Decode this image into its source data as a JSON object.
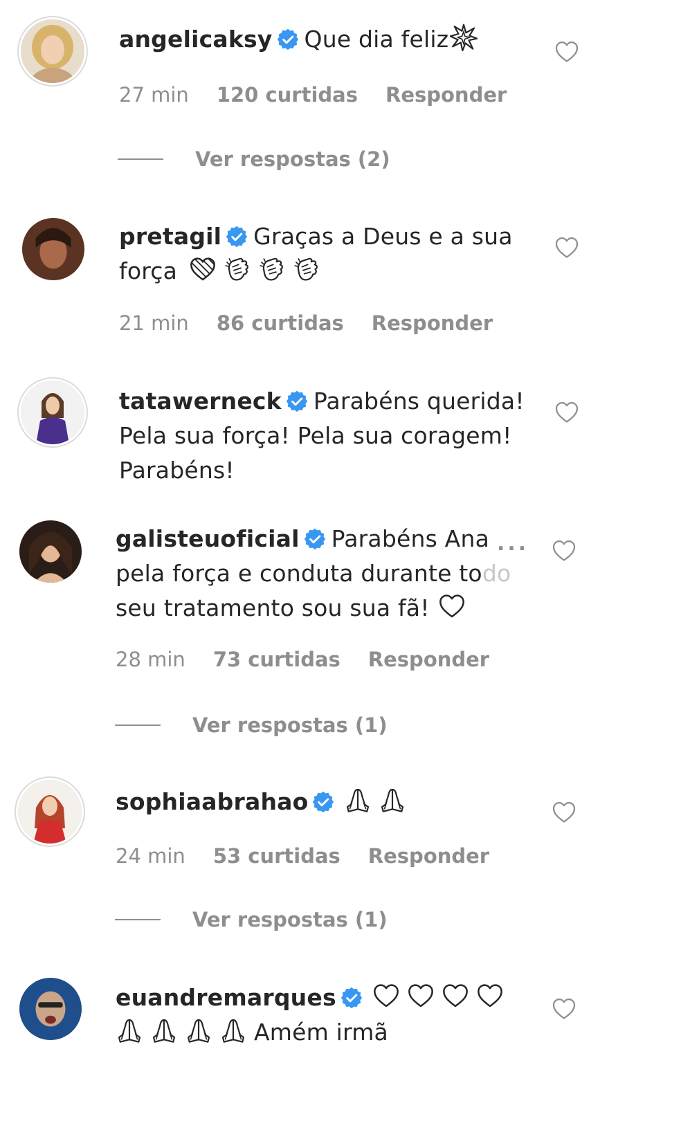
{
  "comments": [
    {
      "username": "angelicaksy",
      "text": "Que dia feliz",
      "emoji_after": "sparkle-burst",
      "time": "27 min",
      "likes": "120 curtidas",
      "reply_label": "Responder",
      "view_replies": "Ver respostas (2)"
    },
    {
      "username": "pretagil",
      "text_line1": "Graças a Deus e a sua",
      "text_line2": "força",
      "emojis": [
        "heart-outline",
        "clapping-hands",
        "clapping-hands",
        "clapping-hands"
      ],
      "time": "21 min",
      "likes": "86 curtidas",
      "reply_label": "Responder"
    },
    {
      "username": "tatawerneck",
      "text_line1": "Parabéns querida!",
      "text_line2": "Pela sua força! Pela sua coragem!",
      "text_line3": "Parabéns!"
    },
    {
      "username": "galisteuoficial",
      "text_line1": "Parabéns Ana",
      "text_line2a": "pela força e conduta durante to",
      "text_line2b": "do",
      "text_line3": "seu tratamento sou sua fã!",
      "time": "28 min",
      "likes": "73 curtidas",
      "reply_label": "Responder",
      "view_replies": "Ver respostas (1)",
      "more_label": "..."
    },
    {
      "username": "sophiaabrahao",
      "emojis": [
        "praying-hands",
        "praying-hands"
      ],
      "time": "24 min",
      "likes": "53 curtidas",
      "reply_label": "Responder",
      "view_replies": "Ver respostas (1)"
    },
    {
      "username": "euandremarques",
      "line1_emojis": [
        "heart-outline",
        "heart-outline",
        "heart-outline",
        "heart-outline"
      ],
      "line2_emojis": [
        "praying-hands",
        "praying-hands",
        "praying-hands",
        "praying-hands"
      ],
      "text_line2": "Amém irmã"
    }
  ],
  "colors": {
    "verified": "#3897f0",
    "meta": "#8e8e8e",
    "text": "#262626"
  }
}
